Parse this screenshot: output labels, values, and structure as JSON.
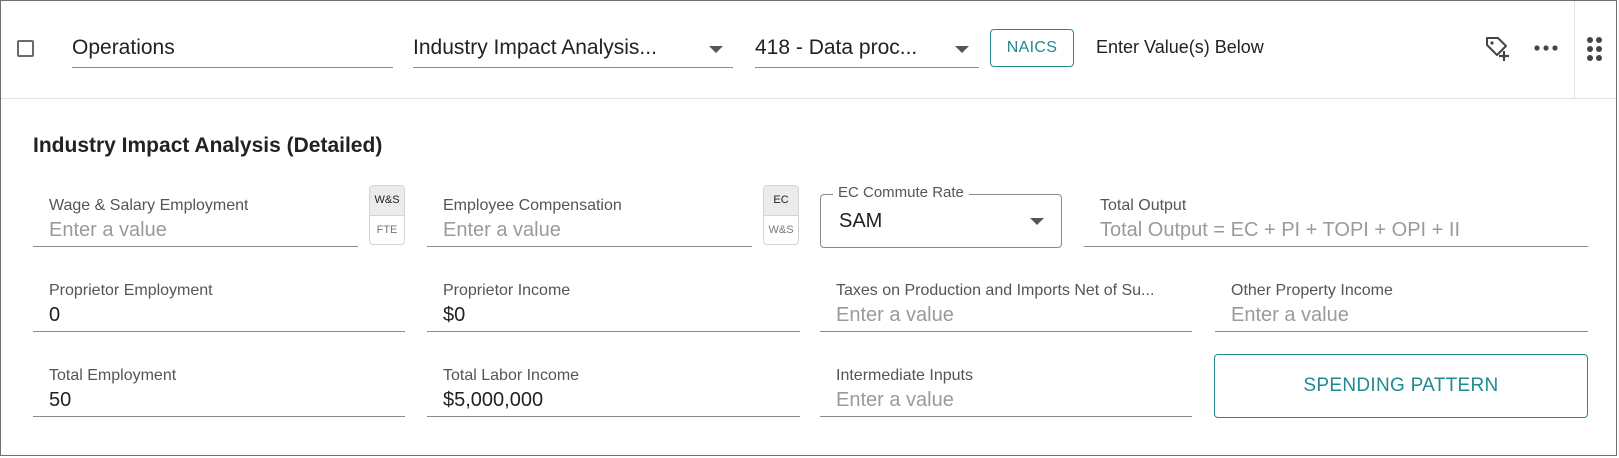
{
  "toolbar": {
    "category_value": "Operations",
    "analysis_type": "Industry Impact Analysis...",
    "industry_code": "418 - Data proc...",
    "naics_label": "NAICS",
    "enter_values_label": "Enter Value(s) Below"
  },
  "section": {
    "title": "Industry Impact Analysis (Detailed)"
  },
  "fields": {
    "wage_salary_employment": {
      "label": "Wage & Salary Employment",
      "placeholder": "Enter a value"
    },
    "employee_compensation": {
      "label": "Employee Compensation",
      "placeholder": "Enter a value"
    },
    "ec_commute_rate": {
      "label": "EC Commute Rate",
      "value": "SAM"
    },
    "total_output": {
      "label": "Total Output",
      "placeholder": "Total Output = EC + PI + TOPI + OPI + II"
    },
    "proprietor_employment": {
      "label": "Proprietor Employment",
      "value": "0"
    },
    "proprietor_income": {
      "label": "Proprietor Income",
      "value": "$0"
    },
    "taxes_on_production": {
      "label": "Taxes on Production and Imports Net of Su...",
      "placeholder": "Enter a value"
    },
    "other_property_income": {
      "label": "Other Property Income",
      "placeholder": "Enter a value"
    },
    "total_employment": {
      "label": "Total Employment",
      "value": "50"
    },
    "total_labor_income": {
      "label": "Total Labor Income",
      "value": "$5,000,000"
    },
    "intermediate_inputs": {
      "label": "Intermediate Inputs",
      "placeholder": "Enter a value"
    }
  },
  "toggles": {
    "employment_unit": {
      "selected": "W&S",
      "other": "FTE"
    },
    "compensation_unit": {
      "selected": "EC",
      "other": "W&S"
    }
  },
  "buttons": {
    "spending_pattern": "SPENDING PATTERN"
  },
  "colors": {
    "accent": "#1f8a8f",
    "border": "#8a8a8a",
    "placeholder": "#9a9a9a"
  }
}
